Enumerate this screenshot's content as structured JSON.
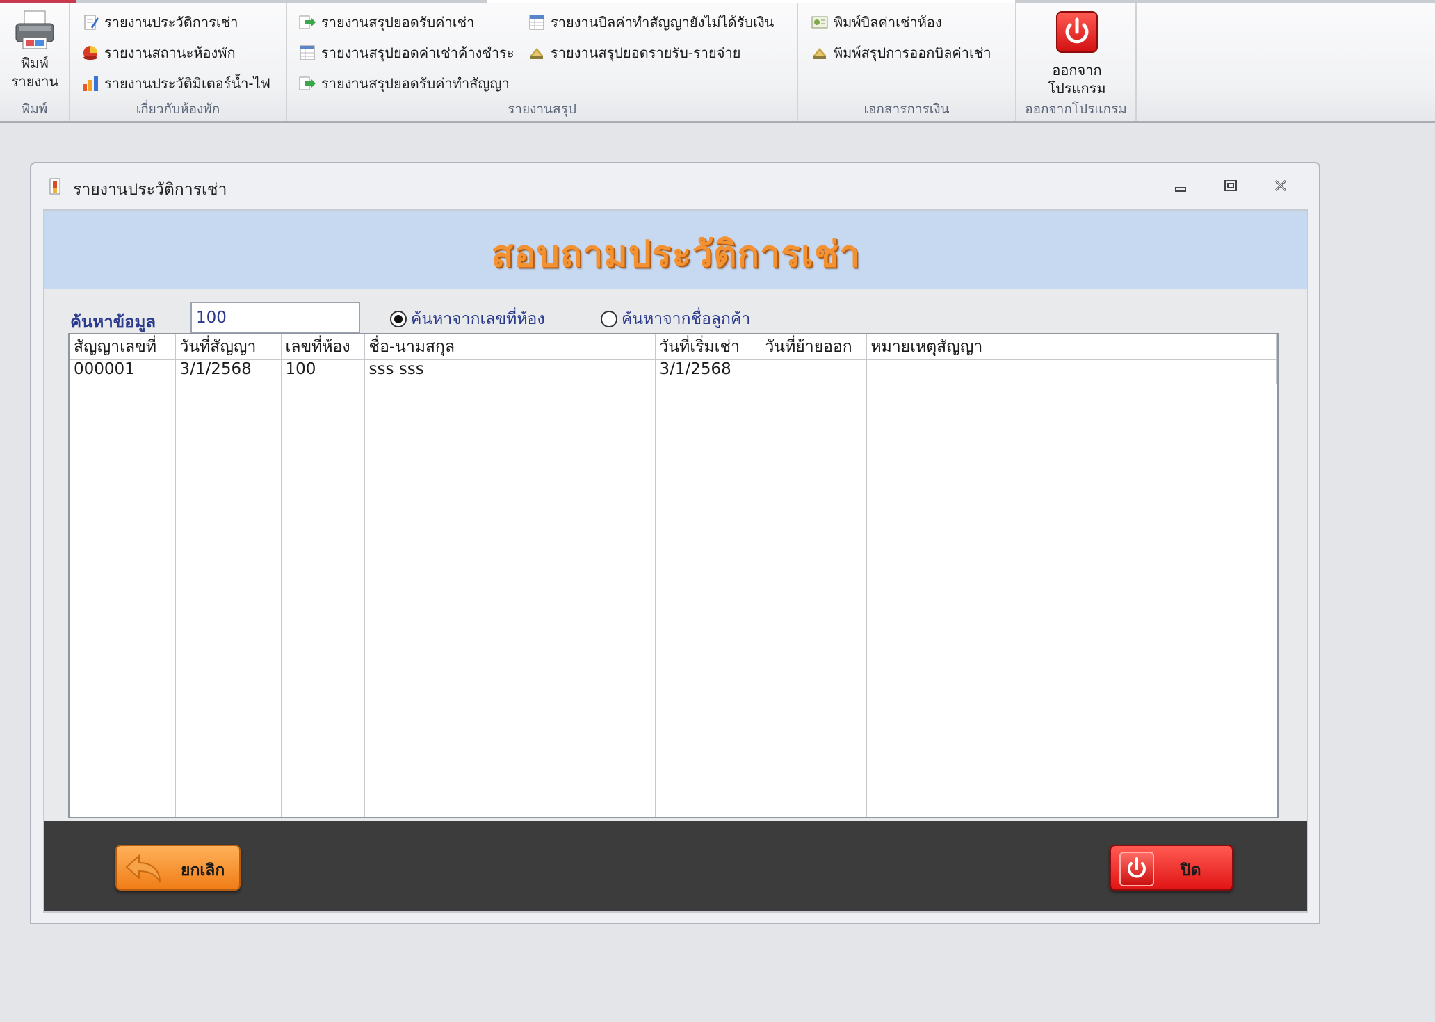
{
  "ribbon": {
    "groups": {
      "print": {
        "label": "พิมพ์",
        "big_button": "พิมพ์\nรายงาน"
      },
      "rooms": {
        "label": "เกี่ยวกับห้องพัก",
        "items": [
          "รายงานประวัติการเช่า",
          "รายงานสถานะห้องพัก",
          "รายงานประวัติมิเตอร์น้ำ-ไฟ"
        ]
      },
      "summary": {
        "label": "รายงานสรุป",
        "items": [
          "รายงานสรุปยอดรับค่าเช่า",
          "รายงานสรุปยอดค่าเช่าค้างชำระ",
          "รายงานสรุปยอดรับค่าทำสัญญา",
          "รายงานบิลค่าทำสัญญายังไม่ได้รับเงิน",
          "รายงานสรุปยอดรายรับ-รายจ่าย"
        ]
      },
      "finance": {
        "label": "เอกสารการเงิน",
        "items": [
          "พิมพ์บิลค่าเช่าห้อง",
          "พิมพ์สรุปการออกบิลค่าเช่า"
        ]
      },
      "exit": {
        "label": "ออกจากโปรแกรม",
        "big_button": "ออกจาก\nโปรแกรม"
      }
    }
  },
  "window": {
    "title": "รายงานประวัติการเช่า",
    "header": "สอบถามประวัติการเช่า",
    "search": {
      "label": "ค้นหาข้อมูล",
      "value": "100",
      "options": [
        "ค้นหาจากเลขที่ห้อง",
        "ค้นหาจากชื่อลูกค้า"
      ],
      "selected_index": 0
    },
    "grid": {
      "columns": [
        "สัญญาเลขที่",
        "วันที่สัญญา",
        "เลขที่ห้อง",
        "ชื่อ-นามสกุล",
        "วันที่เริ่มเช่า",
        "วันที่ย้ายออก",
        "หมายเหตุสัญญา"
      ],
      "rows": [
        [
          "000001",
          "3/1/2568",
          "100",
          "sss sss",
          "3/1/2568",
          "",
          ""
        ]
      ]
    },
    "buttons": {
      "cancel": "ยกเลิก",
      "close": "ปิด"
    }
  },
  "colors": {
    "header_band": "#c6d9f1",
    "header_text": "#f39233",
    "label_blue": "#2b3a8c",
    "bottom_bar": "#3c3c3c",
    "cancel_button": "#f58b22",
    "close_button": "#e81c1c"
  },
  "icons": {
    "printer": "printer-icon",
    "rental_history": "document-pen-icon",
    "room_status": "pie-chart-icon",
    "meter": "bar-chart-icon",
    "summary_arrow": "green-arrow-icon",
    "summary_table": "table-icon",
    "money": "money-icon",
    "power": "power-icon"
  }
}
